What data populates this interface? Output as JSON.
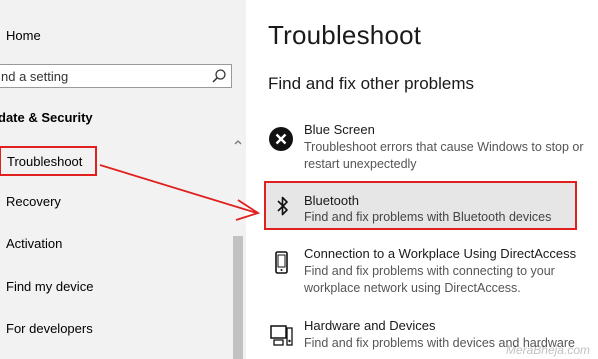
{
  "sidebar": {
    "home_label": "Home",
    "search_placeholder": "nd a setting",
    "section_label": "date & Security",
    "items": [
      {
        "label": "Troubleshoot"
      },
      {
        "label": "Recovery"
      },
      {
        "label": "Activation"
      },
      {
        "label": "Find my device"
      },
      {
        "label": "For developers"
      }
    ]
  },
  "main": {
    "title": "Troubleshoot",
    "subtitle": "Find and fix other problems",
    "items": [
      {
        "title": "Blue Screen",
        "desc": "Troubleshoot errors that cause Windows to stop or restart unexpectedly",
        "icon": "close-circle-icon"
      },
      {
        "title": "Bluetooth",
        "desc": "Find and fix problems with Bluetooth devices",
        "icon": "bluetooth-icon"
      },
      {
        "title": "Connection to a Workplace Using DirectAccess",
        "desc": "Find and fix problems with connecting to your workplace network using DirectAccess.",
        "icon": "phone-icon"
      },
      {
        "title": "Hardware and Devices",
        "desc": "Find and fix problems with devices and hardware",
        "icon": "hardware-icon"
      }
    ]
  },
  "watermark": "MeraBheja.com",
  "colors": {
    "highlight_border": "#e0201e",
    "sidebar_bg": "#f2f2f2",
    "selected_item_bg": "#e6e6e6"
  }
}
